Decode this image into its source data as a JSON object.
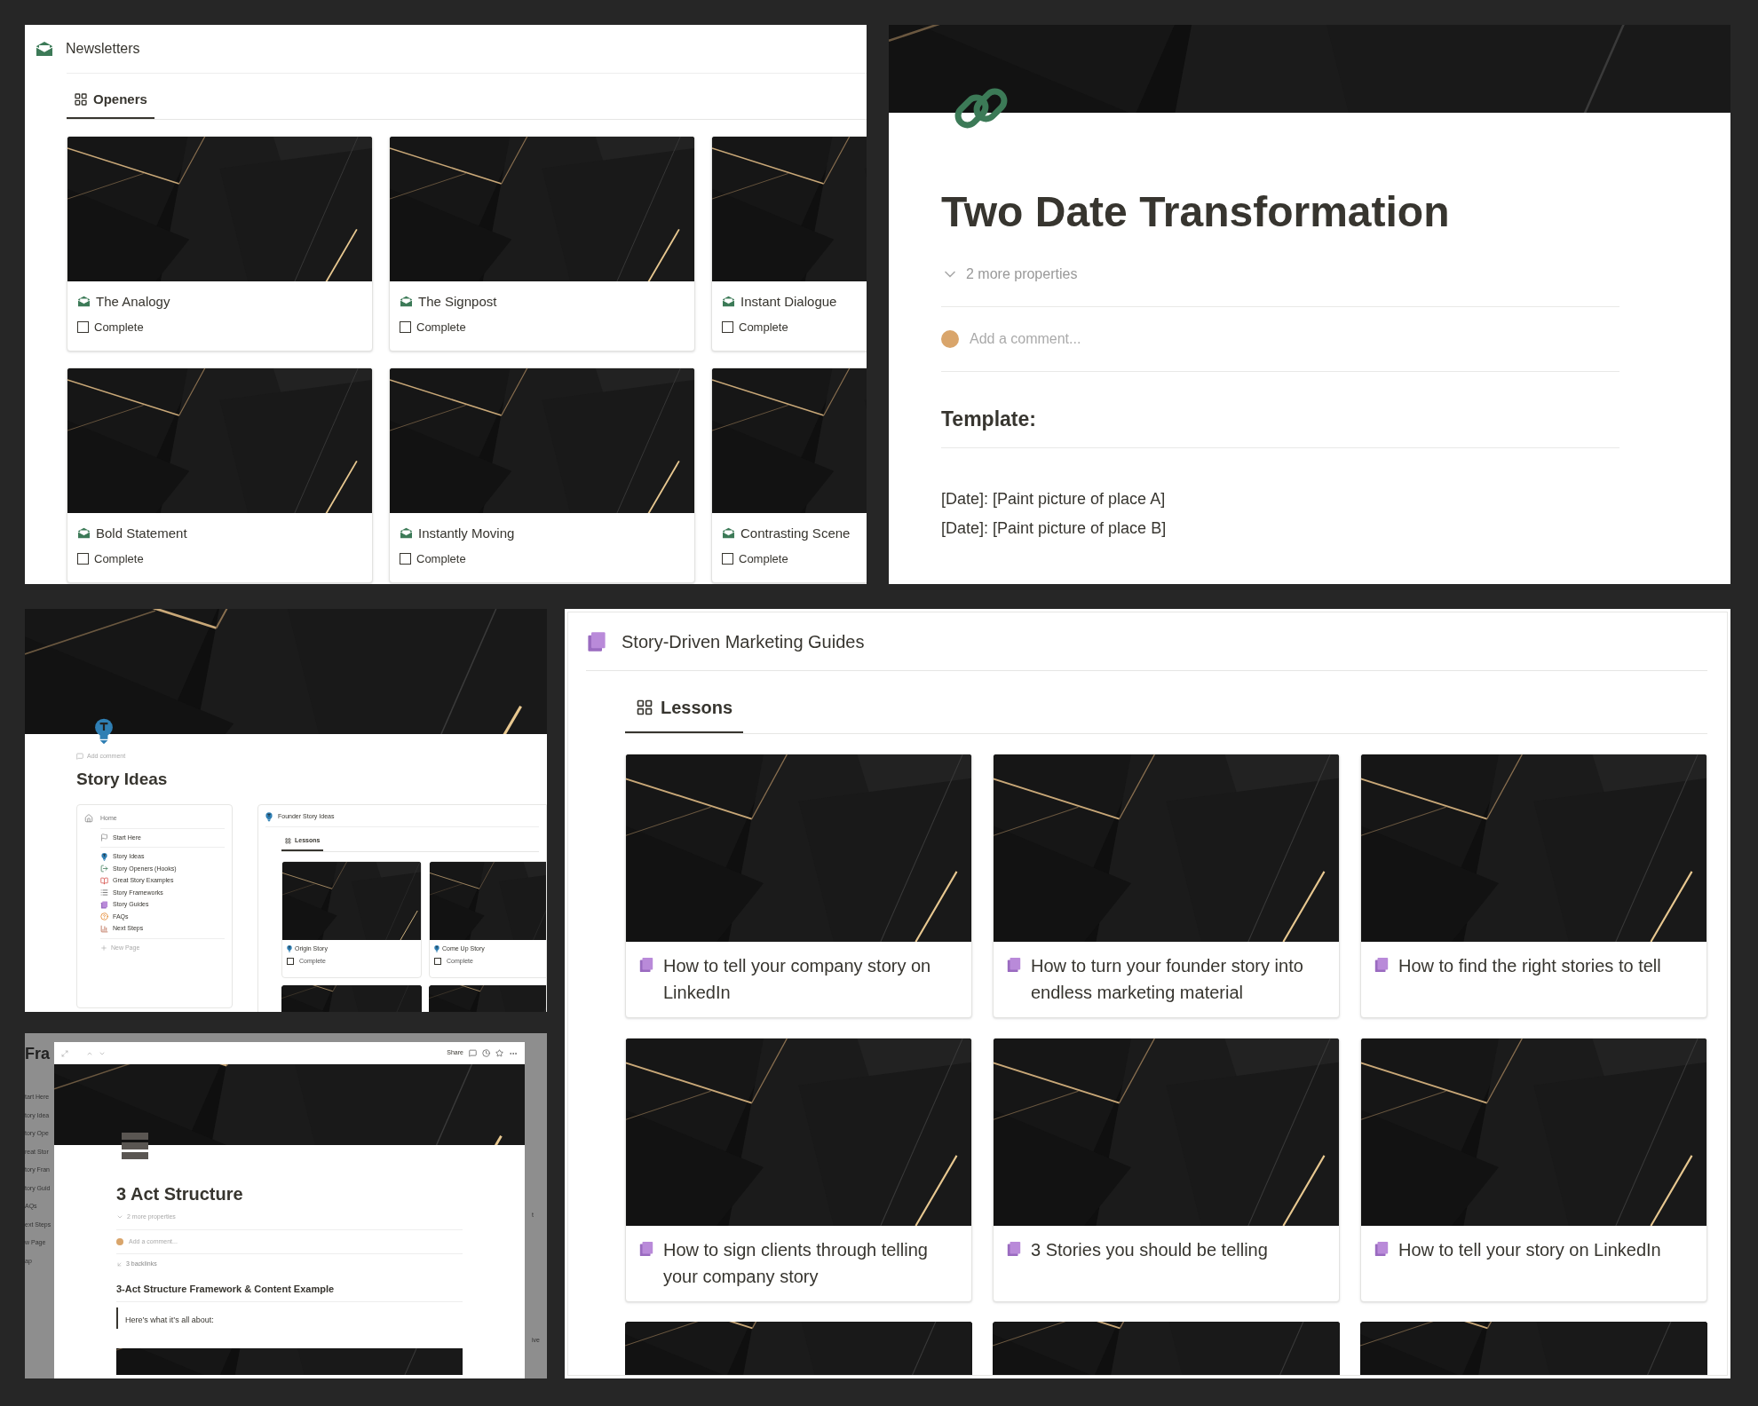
{
  "newsletters_panel": {
    "title": "Newsletters",
    "tabs": [
      {
        "label": "Openers",
        "selected": true
      }
    ],
    "cards": [
      {
        "title": "The Analogy",
        "checkbox": {
          "label": "Complete",
          "checked": false
        }
      },
      {
        "title": "The Signpost",
        "checkbox": {
          "label": "Complete",
          "checked": false
        }
      },
      {
        "title": "Instant Dialogue",
        "checkbox": {
          "label": "Complete",
          "checked": false
        }
      },
      {
        "title": "Bold Statement",
        "checkbox": {
          "label": "Complete",
          "checked": false
        }
      },
      {
        "title": "Instantly Moving",
        "checkbox": {
          "label": "Complete",
          "checked": false
        }
      },
      {
        "title": "Contrasting Scene",
        "checkbox": {
          "label": "Complete",
          "checked": false
        }
      }
    ]
  },
  "page_panel": {
    "title": "Two Date Transformation",
    "properties_toggle": "2 more properties",
    "comment_placeholder": "Add a comment...",
    "heading": "Template:",
    "lines": [
      "[Date]: [Paint picture of place A]",
      "[Date]: [Paint picture of place B]"
    ]
  },
  "story_ideas_panel": {
    "add_comment": "Add comment",
    "title": "Story Ideas",
    "nav": {
      "home": "Home",
      "sections": [
        {
          "items": [
            {
              "label": "Start Here",
              "kind": "flag"
            }
          ]
        },
        {
          "items": [
            {
              "label": "Story Ideas",
              "kind": "bulb"
            },
            {
              "label": "Story Openers (Hooks)",
              "kind": "exit"
            },
            {
              "label": "Great Story Examples",
              "kind": "book"
            },
            {
              "label": "Story Frameworks",
              "kind": "list"
            },
            {
              "label": "Story Guides",
              "kind": "pages"
            },
            {
              "label": "FAQs",
              "kind": "question"
            },
            {
              "label": "Next Steps",
              "kind": "stairs"
            }
          ]
        }
      ],
      "new_page": "New Page"
    },
    "gallery": {
      "title": "Founder Story Ideas",
      "tabs": [
        {
          "label": "Lessons",
          "selected": true
        }
      ],
      "cards": [
        {
          "title": "Origin Story",
          "checkbox": {
            "label": "Complete",
            "checked": false
          }
        },
        {
          "title": "Come Up Story",
          "checkbox": {
            "label": "Complete",
            "checked": false
          }
        }
      ]
    }
  },
  "act_panel": {
    "background_left": [
      {
        "text": "Fra",
        "kind": "heading"
      },
      {
        "text": "tart Here",
        "kind": "item"
      },
      {
        "text": "tory Idea",
        "kind": "item"
      },
      {
        "text": "tory Ope",
        "kind": "item"
      },
      {
        "text": "reat Stor",
        "kind": "item"
      },
      {
        "text": "tory Fran",
        "kind": "item"
      },
      {
        "text": "tory Guid",
        "kind": "item"
      },
      {
        "text": "AQs",
        "kind": "item"
      },
      {
        "text": "ext Steps",
        "kind": "item"
      },
      {
        "text": "w Page",
        "kind": "item"
      },
      {
        "text": "ap",
        "kind": "item"
      }
    ],
    "background_right": [
      "t",
      "ive"
    ],
    "modal": {
      "share": "Share",
      "title": "3 Act Structure",
      "properties_toggle": "2 more properties",
      "comment_placeholder": "Add a comment...",
      "backlinks": "3 backlinks",
      "heading": "3-Act Structure Framework & Content Example",
      "quote": "Here’s what it’s all about:"
    }
  },
  "guides_panel": {
    "title": "Story-Driven Marketing Guides",
    "tabs": [
      {
        "label": "Lessons",
        "selected": true
      }
    ],
    "cards": [
      {
        "title": "How to tell your company story on LinkedIn"
      },
      {
        "title": "How to turn your founder story into endless marketing material"
      },
      {
        "title": "How to find the right stories to tell"
      },
      {
        "title": "How to sign clients through telling your company story"
      },
      {
        "title": "3 Stories you should be telling"
      },
      {
        "title": "How to tell your story on LinkedIn"
      }
    ]
  }
}
